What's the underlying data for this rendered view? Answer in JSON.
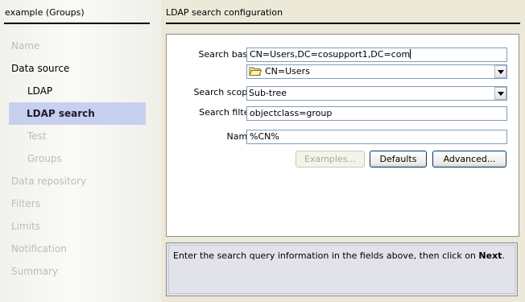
{
  "sidebar": {
    "title": "example (Groups)",
    "items": [
      {
        "label": "Name",
        "state": "dim"
      },
      {
        "label": "Data source",
        "state": "normal"
      },
      {
        "label": "LDAP",
        "state": "normal"
      },
      {
        "label": "LDAP search",
        "state": "selected"
      },
      {
        "label": "Test",
        "state": "dim"
      },
      {
        "label": "Groups",
        "state": "dim"
      },
      {
        "label": "Data repository",
        "state": "dim"
      },
      {
        "label": "Filters",
        "state": "dim"
      },
      {
        "label": "Limits",
        "state": "dim"
      },
      {
        "label": "Notification",
        "state": "dim"
      },
      {
        "label": "Summary",
        "state": "dim"
      }
    ]
  },
  "main": {
    "title": "LDAP search configuration",
    "search_base": {
      "label": "Search base",
      "value": "CN=Users,DC=cosupport1,DC=com",
      "selected_entry": "CN=Users"
    },
    "search_scope": {
      "label": "Search scope",
      "value": "Sub-tree"
    },
    "search_filter": {
      "label": "Search filter",
      "value": "objectclass=group"
    },
    "name": {
      "label": "Name",
      "value": "%CN%"
    },
    "buttons": {
      "examples": "Examples...",
      "defaults": "Defaults",
      "advanced": "Advanced..."
    }
  },
  "info": {
    "text_before": "Enter the search query information in the fields above, then click on ",
    "text_bold": "Next",
    "text_after": "."
  },
  "colors": {
    "selected_bg": "#c8d0f0",
    "field_border": "#7f9db9",
    "button_border": "#003c74"
  }
}
